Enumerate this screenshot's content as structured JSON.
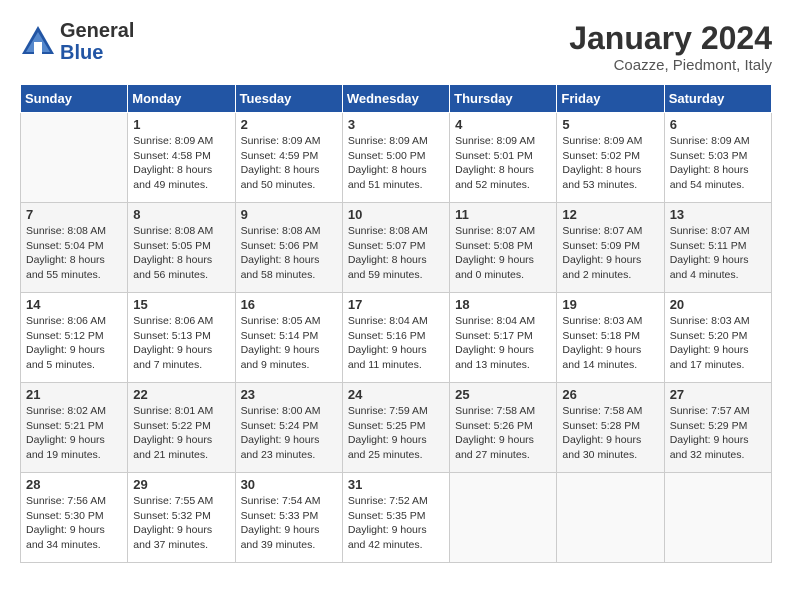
{
  "logo": {
    "general": "General",
    "blue": "Blue"
  },
  "title": "January 2024",
  "location": "Coazze, Piedmont, Italy",
  "weekdays": [
    "Sunday",
    "Monday",
    "Tuesday",
    "Wednesday",
    "Thursday",
    "Friday",
    "Saturday"
  ],
  "weeks": [
    [
      {
        "day": "",
        "info": ""
      },
      {
        "day": "1",
        "info": "Sunrise: 8:09 AM\nSunset: 4:58 PM\nDaylight: 8 hours\nand 49 minutes."
      },
      {
        "day": "2",
        "info": "Sunrise: 8:09 AM\nSunset: 4:59 PM\nDaylight: 8 hours\nand 50 minutes."
      },
      {
        "day": "3",
        "info": "Sunrise: 8:09 AM\nSunset: 5:00 PM\nDaylight: 8 hours\nand 51 minutes."
      },
      {
        "day": "4",
        "info": "Sunrise: 8:09 AM\nSunset: 5:01 PM\nDaylight: 8 hours\nand 52 minutes."
      },
      {
        "day": "5",
        "info": "Sunrise: 8:09 AM\nSunset: 5:02 PM\nDaylight: 8 hours\nand 53 minutes."
      },
      {
        "day": "6",
        "info": "Sunrise: 8:09 AM\nSunset: 5:03 PM\nDaylight: 8 hours\nand 54 minutes."
      }
    ],
    [
      {
        "day": "7",
        "info": "Sunrise: 8:08 AM\nSunset: 5:04 PM\nDaylight: 8 hours\nand 55 minutes."
      },
      {
        "day": "8",
        "info": "Sunrise: 8:08 AM\nSunset: 5:05 PM\nDaylight: 8 hours\nand 56 minutes."
      },
      {
        "day": "9",
        "info": "Sunrise: 8:08 AM\nSunset: 5:06 PM\nDaylight: 8 hours\nand 58 minutes."
      },
      {
        "day": "10",
        "info": "Sunrise: 8:08 AM\nSunset: 5:07 PM\nDaylight: 8 hours\nand 59 minutes."
      },
      {
        "day": "11",
        "info": "Sunrise: 8:07 AM\nSunset: 5:08 PM\nDaylight: 9 hours\nand 0 minutes."
      },
      {
        "day": "12",
        "info": "Sunrise: 8:07 AM\nSunset: 5:09 PM\nDaylight: 9 hours\nand 2 minutes."
      },
      {
        "day": "13",
        "info": "Sunrise: 8:07 AM\nSunset: 5:11 PM\nDaylight: 9 hours\nand 4 minutes."
      }
    ],
    [
      {
        "day": "14",
        "info": "Sunrise: 8:06 AM\nSunset: 5:12 PM\nDaylight: 9 hours\nand 5 minutes."
      },
      {
        "day": "15",
        "info": "Sunrise: 8:06 AM\nSunset: 5:13 PM\nDaylight: 9 hours\nand 7 minutes."
      },
      {
        "day": "16",
        "info": "Sunrise: 8:05 AM\nSunset: 5:14 PM\nDaylight: 9 hours\nand 9 minutes."
      },
      {
        "day": "17",
        "info": "Sunrise: 8:04 AM\nSunset: 5:16 PM\nDaylight: 9 hours\nand 11 minutes."
      },
      {
        "day": "18",
        "info": "Sunrise: 8:04 AM\nSunset: 5:17 PM\nDaylight: 9 hours\nand 13 minutes."
      },
      {
        "day": "19",
        "info": "Sunrise: 8:03 AM\nSunset: 5:18 PM\nDaylight: 9 hours\nand 14 minutes."
      },
      {
        "day": "20",
        "info": "Sunrise: 8:03 AM\nSunset: 5:20 PM\nDaylight: 9 hours\nand 17 minutes."
      }
    ],
    [
      {
        "day": "21",
        "info": "Sunrise: 8:02 AM\nSunset: 5:21 PM\nDaylight: 9 hours\nand 19 minutes."
      },
      {
        "day": "22",
        "info": "Sunrise: 8:01 AM\nSunset: 5:22 PM\nDaylight: 9 hours\nand 21 minutes."
      },
      {
        "day": "23",
        "info": "Sunrise: 8:00 AM\nSunset: 5:24 PM\nDaylight: 9 hours\nand 23 minutes."
      },
      {
        "day": "24",
        "info": "Sunrise: 7:59 AM\nSunset: 5:25 PM\nDaylight: 9 hours\nand 25 minutes."
      },
      {
        "day": "25",
        "info": "Sunrise: 7:58 AM\nSunset: 5:26 PM\nDaylight: 9 hours\nand 27 minutes."
      },
      {
        "day": "26",
        "info": "Sunrise: 7:58 AM\nSunset: 5:28 PM\nDaylight: 9 hours\nand 30 minutes."
      },
      {
        "day": "27",
        "info": "Sunrise: 7:57 AM\nSunset: 5:29 PM\nDaylight: 9 hours\nand 32 minutes."
      }
    ],
    [
      {
        "day": "28",
        "info": "Sunrise: 7:56 AM\nSunset: 5:30 PM\nDaylight: 9 hours\nand 34 minutes."
      },
      {
        "day": "29",
        "info": "Sunrise: 7:55 AM\nSunset: 5:32 PM\nDaylight: 9 hours\nand 37 minutes."
      },
      {
        "day": "30",
        "info": "Sunrise: 7:54 AM\nSunset: 5:33 PM\nDaylight: 9 hours\nand 39 minutes."
      },
      {
        "day": "31",
        "info": "Sunrise: 7:52 AM\nSunset: 5:35 PM\nDaylight: 9 hours\nand 42 minutes."
      },
      {
        "day": "",
        "info": ""
      },
      {
        "day": "",
        "info": ""
      },
      {
        "day": "",
        "info": ""
      }
    ]
  ]
}
